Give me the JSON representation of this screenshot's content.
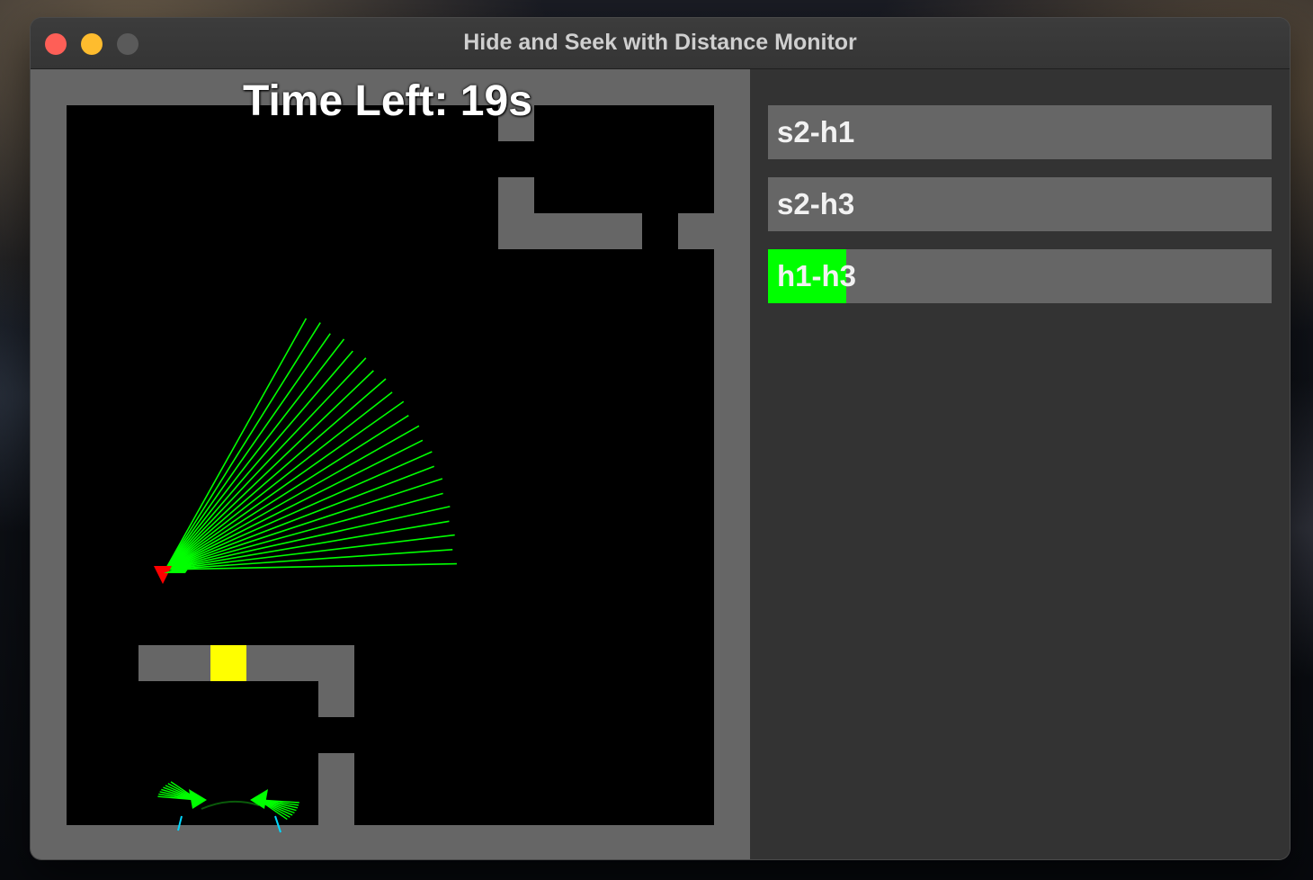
{
  "window": {
    "title": "Hide and Seek with Distance Monitor"
  },
  "hud": {
    "time_left": "Time Left: 19s"
  },
  "distance_monitor": {
    "meters": [
      {
        "label": "s2-h1",
        "fill": 0.0
      },
      {
        "label": "s2-h3",
        "fill": 0.0
      },
      {
        "label": "h1-h3",
        "fill": 0.155
      }
    ],
    "fill_color": "#00ff00",
    "track_color": "#666666"
  },
  "colors": {
    "wall": "#666666",
    "floor": "#000000",
    "seeker": "#ff0000",
    "vision_rays": "#00ff00",
    "goal": "#ffff00",
    "hider_rays": "#00d8ff"
  }
}
